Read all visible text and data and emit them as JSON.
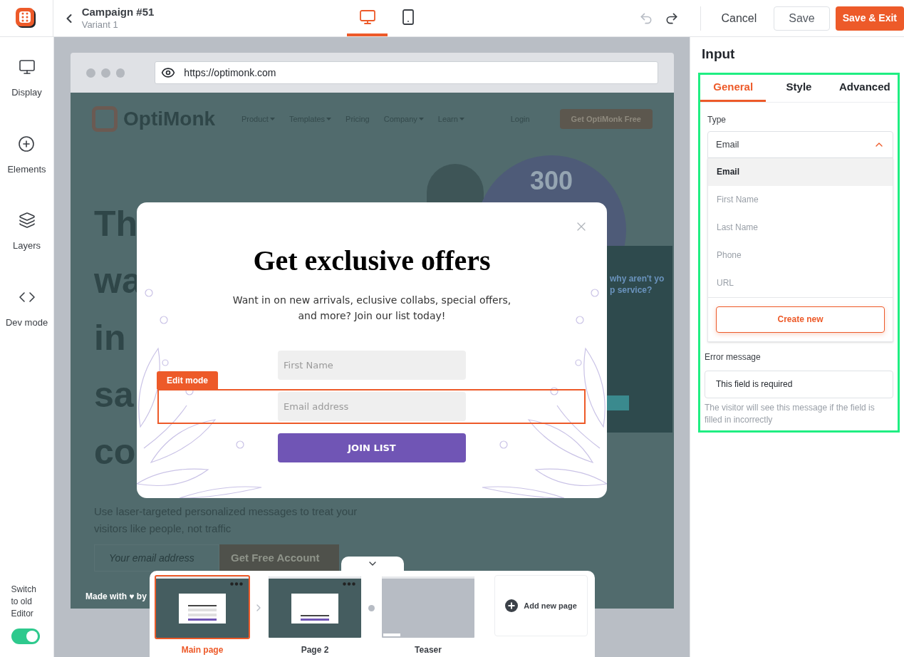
{
  "header": {
    "title": "Campaign #51",
    "subtitle": "Variant 1",
    "devices": [
      {
        "kind": "desktop",
        "selected": true
      },
      {
        "kind": "mobile",
        "selected": false
      }
    ],
    "history": [
      {
        "kind": "undo",
        "disabled": true
      },
      {
        "kind": "redo",
        "disabled": false
      }
    ],
    "buttons": [
      {
        "kind": "text",
        "label": "Cancel"
      },
      {
        "kind": "outline",
        "label": "Save"
      },
      {
        "kind": "primary",
        "label": "Save & Exit"
      }
    ]
  },
  "sidebar": {
    "items": [
      {
        "kind": "display",
        "label": "Display"
      },
      {
        "kind": "elements",
        "label": "Elements"
      },
      {
        "kind": "layers",
        "label": "Layers"
      },
      {
        "kind": "code",
        "label": "Dev mode"
      }
    ],
    "switch": {
      "label": "Switch to old Editor",
      "on": true
    }
  },
  "browser": {
    "url": "https://optimonk.com"
  },
  "website": {
    "logo": "OptiMonk",
    "nav": [
      {
        "label": "Product",
        "dropdown": true
      },
      {
        "label": "Templates",
        "dropdown": true
      },
      {
        "label": "Pricing",
        "dropdown": false
      },
      {
        "label": "Company",
        "dropdown": true
      },
      {
        "label": "Learn",
        "dropdown": true
      }
    ],
    "login": "Login",
    "cta": "Get OptiMonk Free",
    "hero_lines": [
      "Th",
      "wa",
      "in",
      "sa",
      "co"
    ],
    "badge": "300",
    "side_text": [
      "why aren't yo",
      "p service?"
    ],
    "subtitle": "Use laser-targeted personalized messages to treat your visitors like people, not traffic",
    "email_placeholder": "Your email address",
    "submit": "Get Free Account",
    "made_with": "Made with ♥ by"
  },
  "popup": {
    "title": "Get exclusive offers",
    "text": "Want in on new arrivals, eclusive collabs, special offers, and more? Join our list today!",
    "fields": [
      {
        "placeholder": "First Name",
        "selected": false
      },
      {
        "placeholder": "Email address",
        "selected": true
      }
    ],
    "edit_tag": "Edit mode",
    "button": "JOIN LIST"
  },
  "pages": {
    "items": [
      {
        "kind": "popup",
        "label": "Main page",
        "selected": true,
        "menu": true
      },
      {
        "kind": "thankyou",
        "label": "Page 2",
        "selected": false,
        "menu": true
      },
      {
        "kind": "teaser",
        "label": "Teaser",
        "selected": false,
        "menu": false
      }
    ],
    "add": "Add new page"
  },
  "panel": {
    "title": "Input",
    "tabs": [
      {
        "label": "General",
        "selected": true
      },
      {
        "label": "Style",
        "selected": false
      },
      {
        "label": "Advanced",
        "selected": false
      }
    ],
    "type_label": "Type",
    "type_value": "Email",
    "expanded": true,
    "options": [
      {
        "label": "Email",
        "selected": true
      },
      {
        "label": "First Name",
        "selected": false
      },
      {
        "label": "Last Name",
        "selected": false
      },
      {
        "label": "Phone",
        "selected": false
      },
      {
        "label": "URL",
        "selected": false
      }
    ],
    "create": "Create new",
    "error_label": "Error message",
    "error_value": "This field is required",
    "help": "The visitor will see this message if the field is filled in incorrectly"
  }
}
